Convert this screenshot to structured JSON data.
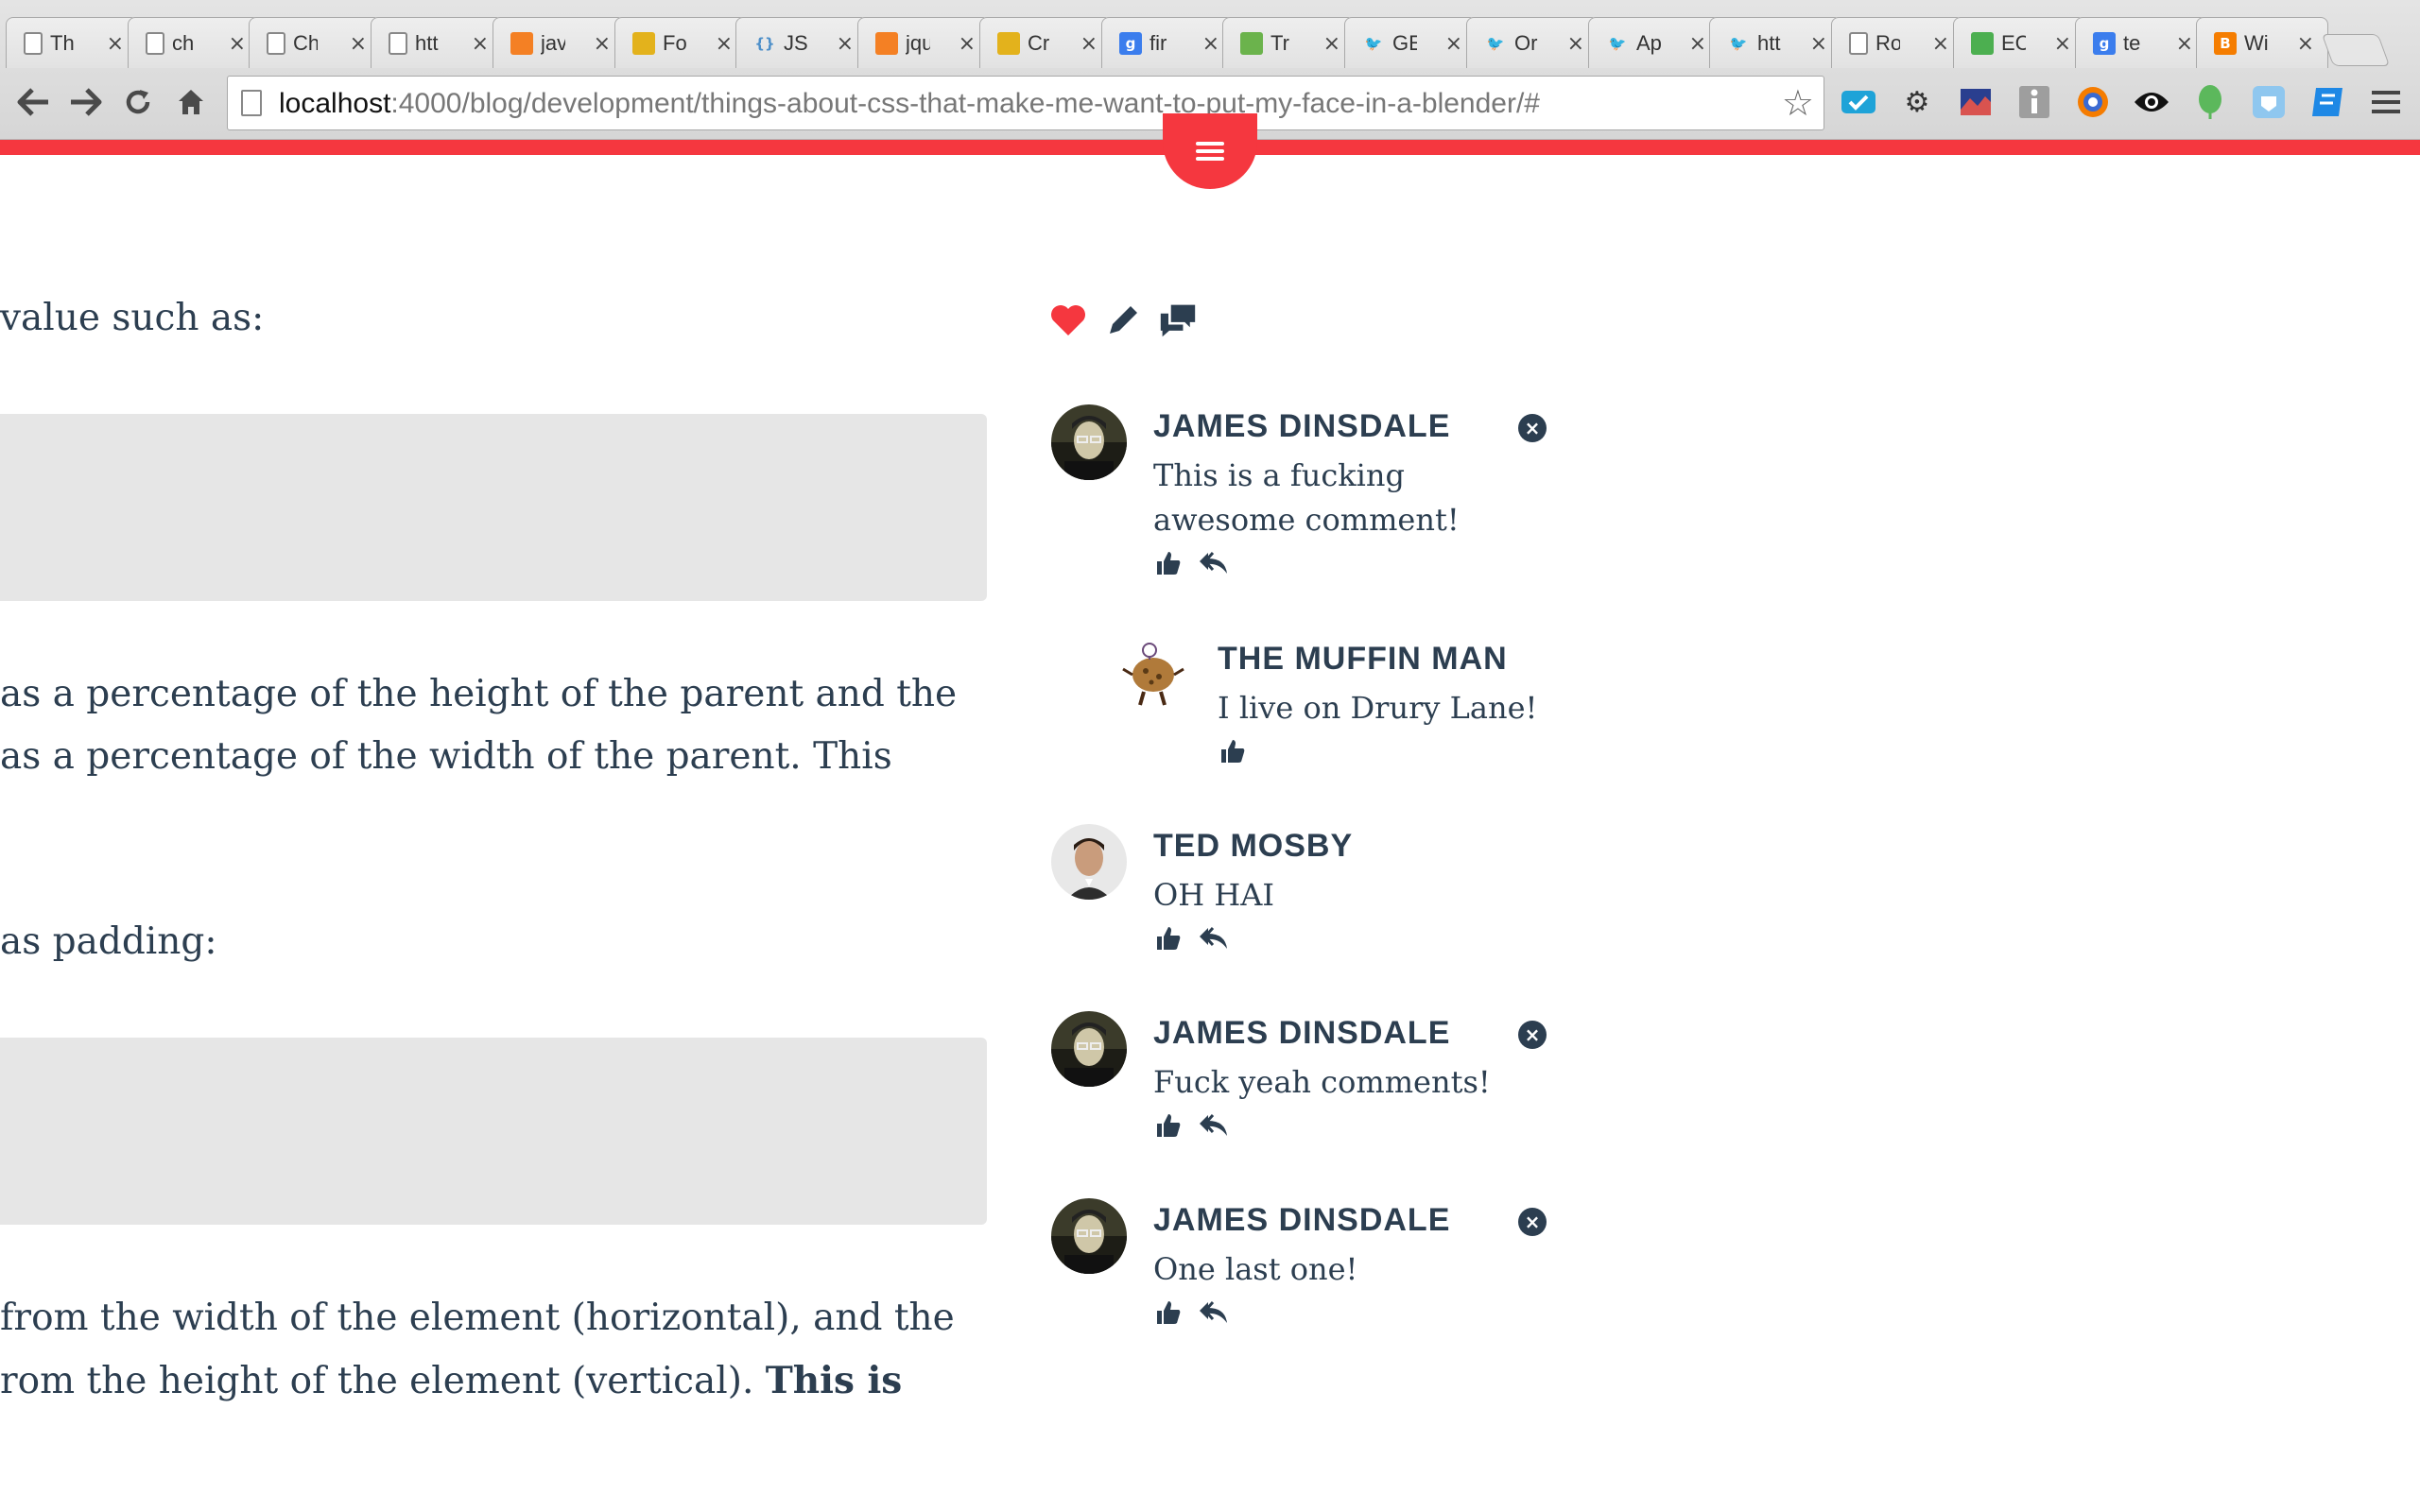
{
  "browser": {
    "tabs": [
      {
        "title": "Th",
        "icon": "page-icon",
        "color": "#ffffff"
      },
      {
        "title": "ch",
        "icon": "page-icon",
        "color": "#ffffff"
      },
      {
        "title": "Ch",
        "icon": "page-icon",
        "color": "#ffffff"
      },
      {
        "title": "htt",
        "icon": "page-icon",
        "color": "#ffffff"
      },
      {
        "title": "jav",
        "icon": "stackoverflow-icon",
        "color": "#f48024"
      },
      {
        "title": "Fo",
        "icon": "database-icon",
        "color": "#e3b21c"
      },
      {
        "title": "JSO",
        "icon": "json-icon",
        "color": "#4d8fc9"
      },
      {
        "title": "jqu",
        "icon": "stackoverflow-icon",
        "color": "#f48024"
      },
      {
        "title": "Cr",
        "icon": "database-icon",
        "color": "#e3b21c"
      },
      {
        "title": "fir",
        "icon": "google-icon",
        "color": "#3b7ded"
      },
      {
        "title": "Tr",
        "icon": "w3schools-icon",
        "color": "#6bb34c"
      },
      {
        "title": "GE",
        "icon": "twitter-icon",
        "color": "#2aa3ef"
      },
      {
        "title": "Or",
        "icon": "twitter-icon",
        "color": "#2aa3ef"
      },
      {
        "title": "Ap",
        "icon": "twitter-icon",
        "color": "#2aa3ef"
      },
      {
        "title": "htt",
        "icon": "twitter-icon",
        "color": "#2aa3ef"
      },
      {
        "title": "Ro",
        "icon": "page-icon",
        "color": "#ffffff"
      },
      {
        "title": "EC",
        "icon": "maps-icon",
        "color": "#4caf50"
      },
      {
        "title": "te",
        "icon": "google-icon",
        "color": "#3b7ded"
      },
      {
        "title": "Wi",
        "icon": "blogger-icon",
        "color": "#f57d00"
      }
    ],
    "url_host": "localhost",
    "url_rest": ":4000/blog/development/things-about-css-that-make-me-want-to-put-my-face-in-a-blender/#"
  },
  "article": {
    "line1": "value such as:",
    "line2": "as a percentage of the height of the parent and the",
    "line3": "as a percentage of the width of the parent. This",
    "line4": "as padding:",
    "line5": "from the width of the element (horizontal), and the",
    "line6a": "rom the height of the element (vertical). ",
    "line6b": "This is"
  },
  "accent_color": "#f5373f",
  "text_color": "#2c3e50",
  "comments": [
    {
      "author": "JAMES DINSDALE",
      "text": "This is a fucking awesome comment!",
      "avatar": "james-avatar",
      "deletable": true,
      "reply": true
    },
    {
      "author": "THE MUFFIN MAN",
      "text": "I live on Drury Lane!",
      "avatar": "muffin-avatar",
      "deletable": false,
      "reply": false
    },
    {
      "author": "TED MOSBY",
      "text": "OH HAI",
      "avatar": "ted-avatar",
      "deletable": false,
      "reply": true
    },
    {
      "author": "JAMES DINSDALE",
      "text": "Fuck yeah comments!",
      "avatar": "james-avatar",
      "deletable": true,
      "reply": true
    },
    {
      "author": "JAMES DINSDALE",
      "text": "One last one!",
      "avatar": "james-avatar",
      "deletable": true,
      "reply": true
    }
  ]
}
